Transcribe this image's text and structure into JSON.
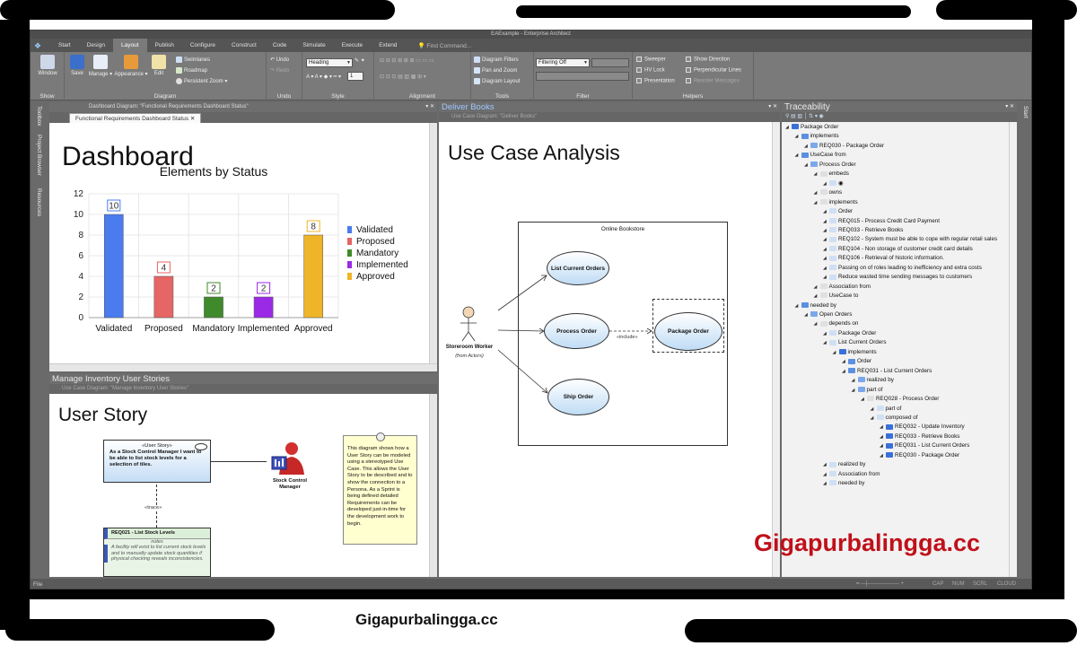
{
  "app": {
    "title": "EAExample - Enterprise Architect",
    "menu_tabs": [
      "Start",
      "Design",
      "Layout",
      "Publish",
      "Configure",
      "Construct",
      "Code",
      "Simulate",
      "Execute",
      "Extend"
    ],
    "active_tab": "Layout",
    "find_command": "Find Command..."
  },
  "ribbon": {
    "window": "Window",
    "save": "Save",
    "manage": "Manage",
    "appearance": "Appearance",
    "edit": "Edit",
    "swimlanes": "Swimlanes",
    "roadmap": "Roadmap",
    "persistent_zoom": "Persistent Zoom",
    "undo": "Undo",
    "redo": "Redo",
    "style_combo": "Heading",
    "size_combo": "1",
    "diagram_filters": "Diagram Filters",
    "pan_zoom": "Pan and Zoom",
    "diagram_layout": "Diagram Layout",
    "filter_combo": "Filtering Off",
    "sweeper": "Sweeper",
    "hv_lock": "HV Lock",
    "presentation": "Presentation",
    "show_direction": "Show Direction",
    "perpendicular_lines": "Perpendicular Lines",
    "reorder_messages": "Reorder Messages",
    "groups": {
      "show": "Show",
      "diagram": "Diagram",
      "undo": "Undo",
      "style": "Style",
      "alignment": "Alignment",
      "tools": "Tools",
      "filter": "Filter",
      "helpers": "Helpers"
    }
  },
  "left_sidebar": [
    "Toolbox",
    "Project Browser",
    "Resources"
  ],
  "right_sidebar": "Start",
  "dashboard_panel": {
    "header": "Dashboard Diagram: \"Functional Requirements Dashboard Status\"",
    "tab": "Functional Requirements Dashboard Status",
    "title": "Dashboard"
  },
  "chart_data": {
    "type": "bar",
    "title": "Elements by Status",
    "categories": [
      "Validated",
      "Proposed",
      "Mandatory",
      "Implemented",
      "Approved"
    ],
    "values": [
      10,
      4,
      2,
      2,
      8
    ],
    "colors": [
      "#4a7cf0",
      "#e66565",
      "#3f8a2a",
      "#9a2ae6",
      "#f0b428"
    ],
    "ylim": [
      0,
      12
    ],
    "yticks": [
      "0",
      "2",
      "4",
      "6",
      "8",
      "10",
      "12"
    ],
    "legend": [
      "Validated",
      "Proposed",
      "Mandatory",
      "Implemented",
      "Approved"
    ],
    "legend_position": "right",
    "grid": true
  },
  "inventory_panel": {
    "title": "Manage Inventory User Stories",
    "subheader": "Use Case Diagram: \"Manage Inventory User Stories\"",
    "heading": "User Story",
    "story_stereotype": "«User Story»",
    "story_text": "As a Stock Control Manager I want to be able to list stock levels for a selection of tiles.",
    "actor": "Stock Control Manager",
    "trace": "«trace»",
    "req_title": "REQ021 - List Stock Levels",
    "req_notes_label": "notes",
    "req_notes": "A facility will exist to list current stock levels and to manually update stock quantities if physical checking reveals inconsistencies.",
    "note": "This diagram shows how a User Story can be modeled using a stereotyped Use Case. This allows the User Story to be described and to show the connection to a Persona. As a Sprint is being defined detailed Requirements can be developed just-in-time for the development work to begin."
  },
  "books_panel": {
    "title": "Deliver Books",
    "subheader": "Use Case Diagram: \"Deliver Books\"",
    "heading": "Use Case Analysis",
    "boundary": "Online Bookstore",
    "actor": "Storeroom Worker",
    "actor_note": "(from Actors)",
    "use_cases": [
      "List Current Orders",
      "Process Order",
      "Package Order",
      "Ship Order"
    ],
    "include": "«include»"
  },
  "traceability": {
    "title": "Traceability",
    "items": [
      {
        "d": 0,
        "t": "Package Order"
      },
      {
        "d": 1,
        "t": "implements"
      },
      {
        "d": 2,
        "t": "REQ030 - Package Order"
      },
      {
        "d": 1,
        "t": "UseCase from"
      },
      {
        "d": 2,
        "t": "Process Order"
      },
      {
        "d": 3,
        "t": "embeds"
      },
      {
        "d": 4,
        "t": "◉"
      },
      {
        "d": 3,
        "t": "owns"
      },
      {
        "d": 3,
        "t": "implements"
      },
      {
        "d": 4,
        "t": "Order"
      },
      {
        "d": 4,
        "t": "REQ015 - Process Credit Card Payment"
      },
      {
        "d": 4,
        "t": "REQ033 - Retrieve Books"
      },
      {
        "d": 4,
        "t": "REQ102 - System must be able to cope with regular retail sales"
      },
      {
        "d": 4,
        "t": "REQ104 - Non storage of customer credit card details"
      },
      {
        "d": 4,
        "t": "REQ106 - Retrieval of historic information."
      },
      {
        "d": 4,
        "t": "Passing on of roles leading to inefficiency and extra costs"
      },
      {
        "d": 4,
        "t": "Reduce wasted time sending messages to customers"
      },
      {
        "d": 3,
        "t": "Association from"
      },
      {
        "d": 3,
        "t": "UseCase to"
      },
      {
        "d": 1,
        "t": "needed by"
      },
      {
        "d": 2,
        "t": "Open Orders"
      },
      {
        "d": 3,
        "t": "depends on"
      },
      {
        "d": 4,
        "t": "Package Order"
      },
      {
        "d": 4,
        "t": "List Current Orders"
      },
      {
        "d": 5,
        "t": "implements"
      },
      {
        "d": 6,
        "t": "Order"
      },
      {
        "d": 6,
        "t": "REQ031 - List Current Orders"
      },
      {
        "d": 7,
        "t": "realized by"
      },
      {
        "d": 7,
        "t": "part of"
      },
      {
        "d": 8,
        "t": "REQ028 - Process Order"
      },
      {
        "d": 9,
        "t": "part of"
      },
      {
        "d": 9,
        "t": "composed of"
      },
      {
        "d": 10,
        "t": "REQ032 - Update Inventory"
      },
      {
        "d": 10,
        "t": "REQ033 - Retrieve Books"
      },
      {
        "d": 10,
        "t": "REQ031 - List Current Orders"
      },
      {
        "d": 10,
        "t": "REQ030 - Package Order"
      },
      {
        "d": 4,
        "t": "realized by"
      },
      {
        "d": 4,
        "t": "Association from"
      },
      {
        "d": 4,
        "t": "needed by"
      }
    ]
  },
  "status": {
    "left": "File",
    "indicators": [
      "CAP",
      "NUM",
      "SCRL",
      "CLOUD"
    ]
  },
  "watermark": "Gigapurbalingga.cc",
  "caption": "Gigapurbalingga.cc"
}
